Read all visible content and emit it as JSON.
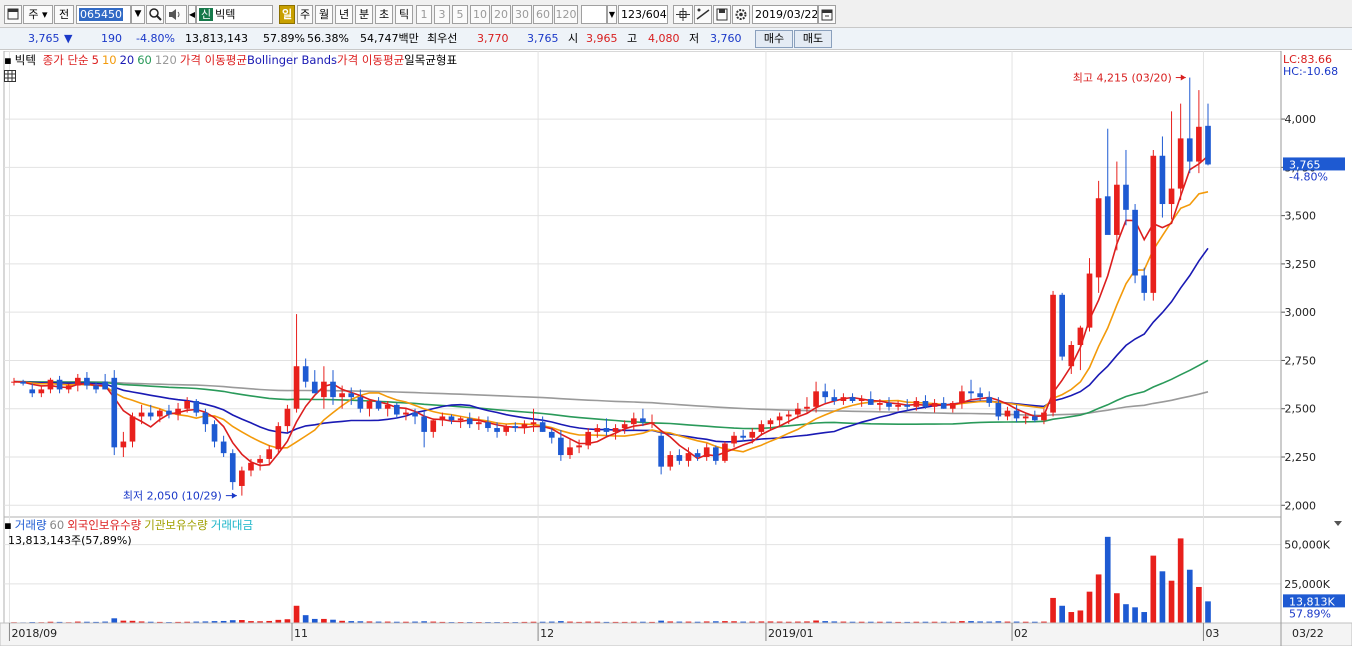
{
  "toolbar": {
    "type_selector": "주",
    "prev_label": "전",
    "stock_code": "065450",
    "badge": "신",
    "stock_name": "빅텍",
    "periods": [
      {
        "label": "일",
        "active": true
      },
      {
        "label": "주",
        "active": false
      },
      {
        "label": "월",
        "active": false
      },
      {
        "label": "년",
        "active": false
      },
      {
        "label": "분",
        "active": false
      },
      {
        "label": "초",
        "active": false
      },
      {
        "label": "틱",
        "active": false
      }
    ],
    "intervals": [
      "1",
      "3",
      "5",
      "10",
      "20",
      "30",
      "60",
      "120"
    ],
    "count_display": "123",
    "count_total": "/604",
    "date": "2019/03/22"
  },
  "quote": {
    "price": "3,765",
    "arrow": "▼",
    "change": "190",
    "change_pct": "-4.80%",
    "volume": "13,813,143",
    "volume_ratio": "57.89%",
    "turnover": "56.38%",
    "amount": "54,747백만",
    "best_label": "최우선",
    "best_ask": "3,770",
    "best_bid": "3,765",
    "open_label": "시",
    "open": "3,965",
    "high_label": "고",
    "high": "4,080",
    "low_label": "저",
    "low": "3,760",
    "buy_button": "매수",
    "sell_button": "매도"
  },
  "legend": {
    "name": "빅텍",
    "ma_title": "종가 단순",
    "ma_periods": [
      "5",
      "10",
      "20",
      "60",
      "120"
    ],
    "ma_label1": "가격 이동평균",
    "bollinger": "Bollinger Bands",
    "ma_label2": "가격 이동평균",
    "ichimoku": "일목균형표"
  },
  "volume_legend": {
    "volume": "거래량",
    "volume_period": "60",
    "foreign": "외국인보유수량",
    "institution": "기관보유수량",
    "amount": "거래대금",
    "sub": "13,813,143주(57,89%)"
  },
  "annotations": {
    "lc": "LC:83.66",
    "hc": "HC:-10.68",
    "high_label": "최고 4,215 (03/20)",
    "low_label": "최저 2,050 (10/29)",
    "price_tag": "3,765",
    "price_pct": "-4.80%",
    "vol_tag": "13,813K",
    "vol_pct": "57.89%",
    "last_date": "03/22"
  },
  "colors": {
    "up": "#e8201c",
    "down": "#1e5ad2",
    "ma5": "#dc1e1e",
    "ma10": "#f39a0a",
    "ma20": "#1a1ab4",
    "ma60": "#2a9a5a",
    "ma120": "#9a9a9a"
  },
  "chart_data": {
    "type": "candlestick",
    "title": "빅텍",
    "y_ticks": [
      2000,
      2250,
      2500,
      2750,
      3000,
      3250,
      3500,
      3750,
      4000
    ],
    "y_tick_labels": [
      "2,000",
      "2,250",
      "2,500",
      "2,750",
      "3,000",
      "3,250",
      "3,500",
      "3,750",
      "4,000"
    ],
    "ylim": [
      1960,
      4280
    ],
    "vol_ticks": [
      25000,
      50000
    ],
    "vol_tick_labels": [
      "25,000K",
      "50,000K"
    ],
    "vol_lim": [
      0,
      60000
    ],
    "x_labels": [
      {
        "label": "2018/09",
        "index": 0
      },
      {
        "label": "11",
        "index": 31
      },
      {
        "label": "12",
        "index": 58
      },
      {
        "label": "2019/01",
        "index": 83
      },
      {
        "label": "02",
        "index": 110
      },
      {
        "label": "03",
        "index": 131
      }
    ],
    "candles": [
      [
        2640,
        2660,
        2620,
        2640,
        500
      ],
      [
        2640,
        2650,
        2620,
        2630,
        400
      ],
      [
        2600,
        2630,
        2560,
        2580,
        600
      ],
      [
        2580,
        2620,
        2560,
        2600,
        500
      ],
      [
        2600,
        2660,
        2580,
        2650,
        800
      ],
      [
        2650,
        2670,
        2580,
        2600,
        700
      ],
      [
        2600,
        2630,
        2580,
        2620,
        500
      ],
      [
        2620,
        2680,
        2590,
        2660,
        900
      ],
      [
        2660,
        2690,
        2600,
        2620,
        800
      ],
      [
        2620,
        2640,
        2580,
        2600,
        700
      ],
      [
        2640,
        2680,
        2600,
        2600,
        900
      ],
      [
        2660,
        2700,
        2260,
        2300,
        3000
      ],
      [
        2300,
        2380,
        2250,
        2330,
        1500
      ],
      [
        2330,
        2480,
        2300,
        2460,
        1400
      ],
      [
        2460,
        2520,
        2420,
        2480,
        1000
      ],
      [
        2480,
        2520,
        2440,
        2460,
        800
      ],
      [
        2460,
        2500,
        2430,
        2490,
        700
      ],
      [
        2490,
        2520,
        2450,
        2470,
        600
      ],
      [
        2470,
        2530,
        2440,
        2500,
        700
      ],
      [
        2500,
        2560,
        2480,
        2540,
        800
      ],
      [
        2540,
        2550,
        2460,
        2480,
        900
      ],
      [
        2480,
        2500,
        2380,
        2420,
        1000
      ],
      [
        2420,
        2440,
        2300,
        2330,
        1200
      ],
      [
        2330,
        2360,
        2250,
        2270,
        1300
      ],
      [
        2270,
        2290,
        2080,
        2120,
        1800
      ],
      [
        2100,
        2200,
        2050,
        2180,
        1900
      ],
      [
        2180,
        2240,
        2150,
        2220,
        1200
      ],
      [
        2220,
        2260,
        2180,
        2240,
        1100
      ],
      [
        2240,
        2310,
        2210,
        2290,
        1300
      ],
      [
        2290,
        2430,
        2270,
        2410,
        2000
      ],
      [
        2410,
        2520,
        2380,
        2500,
        2400
      ],
      [
        2500,
        2990,
        2480,
        2720,
        11000
      ],
      [
        2720,
        2760,
        2610,
        2640,
        5000
      ],
      [
        2640,
        2700,
        2580,
        2580,
        2600
      ],
      [
        2560,
        2720,
        2500,
        2640,
        2600
      ],
      [
        2640,
        2700,
        2520,
        2560,
        2100
      ],
      [
        2560,
        2620,
        2500,
        2580,
        1400
      ],
      [
        2580,
        2610,
        2520,
        2560,
        1200
      ],
      [
        2560,
        2600,
        2480,
        2500,
        1100
      ],
      [
        2500,
        2550,
        2460,
        2540,
        1000
      ],
      [
        2540,
        2560,
        2490,
        2500,
        900
      ],
      [
        2500,
        2540,
        2460,
        2520,
        900
      ],
      [
        2520,
        2530,
        2450,
        2470,
        800
      ],
      [
        2470,
        2500,
        2440,
        2480,
        800
      ],
      [
        2480,
        2500,
        2420,
        2460,
        900
      ],
      [
        2460,
        2490,
        2300,
        2380,
        1100
      ],
      [
        2380,
        2450,
        2350,
        2440,
        900
      ],
      [
        2440,
        2480,
        2410,
        2460,
        700
      ],
      [
        2460,
        2470,
        2420,
        2440,
        600
      ],
      [
        2440,
        2460,
        2400,
        2450,
        600
      ],
      [
        2450,
        2480,
        2400,
        2420,
        600
      ],
      [
        2420,
        2460,
        2390,
        2430,
        600
      ],
      [
        2430,
        2460,
        2380,
        2400,
        600
      ],
      [
        2400,
        2430,
        2350,
        2380,
        600
      ],
      [
        2380,
        2420,
        2360,
        2410,
        600
      ],
      [
        2410,
        2430,
        2380,
        2400,
        600
      ],
      [
        2400,
        2440,
        2370,
        2420,
        700
      ],
      [
        2420,
        2500,
        2380,
        2430,
        800
      ],
      [
        2430,
        2460,
        2380,
        2380,
        800
      ],
      [
        2380,
        2400,
        2320,
        2350,
        900
      ],
      [
        2350,
        2390,
        2230,
        2260,
        1200
      ],
      [
        2260,
        2340,
        2240,
        2300,
        900
      ],
      [
        2300,
        2340,
        2270,
        2310,
        700
      ],
      [
        2310,
        2400,
        2290,
        2380,
        900
      ],
      [
        2380,
        2420,
        2350,
        2400,
        800
      ],
      [
        2400,
        2450,
        2360,
        2380,
        700
      ],
      [
        2380,
        2420,
        2340,
        2400,
        700
      ],
      [
        2400,
        2440,
        2370,
        2420,
        700
      ],
      [
        2420,
        2480,
        2390,
        2450,
        800
      ],
      [
        2450,
        2500,
        2410,
        2430,
        800
      ],
      [
        2430,
        2470,
        2400,
        2430,
        700
      ],
      [
        2360,
        2380,
        2160,
        2200,
        1500
      ],
      [
        2200,
        2280,
        2180,
        2260,
        1000
      ],
      [
        2260,
        2290,
        2210,
        2230,
        900
      ],
      [
        2230,
        2300,
        2200,
        2270,
        900
      ],
      [
        2270,
        2290,
        2230,
        2250,
        800
      ],
      [
        2250,
        2320,
        2230,
        2300,
        1000
      ],
      [
        2300,
        2310,
        2210,
        2230,
        1100
      ],
      [
        2230,
        2330,
        2220,
        2320,
        1200
      ],
      [
        2320,
        2380,
        2300,
        2360,
        1100
      ],
      [
        2360,
        2390,
        2330,
        2350,
        900
      ],
      [
        2350,
        2400,
        2320,
        2380,
        900
      ],
      [
        2380,
        2440,
        2360,
        2420,
        1000
      ],
      [
        2420,
        2450,
        2390,
        2440,
        1000
      ],
      [
        2440,
        2480,
        2410,
        2460,
        900
      ],
      [
        2460,
        2490,
        2420,
        2470,
        800
      ],
      [
        2470,
        2530,
        2450,
        2500,
        900
      ],
      [
        2500,
        2560,
        2480,
        2510,
        1000
      ],
      [
        2510,
        2640,
        2480,
        2590,
        1600
      ],
      [
        2590,
        2630,
        2530,
        2560,
        1200
      ],
      [
        2560,
        2600,
        2520,
        2540,
        1000
      ],
      [
        2540,
        2580,
        2520,
        2560,
        900
      ],
      [
        2560,
        2580,
        2530,
        2540,
        800
      ],
      [
        2540,
        2570,
        2510,
        2550,
        800
      ],
      [
        2550,
        2590,
        2520,
        2520,
        800
      ],
      [
        2520,
        2550,
        2490,
        2530,
        800
      ],
      [
        2530,
        2560,
        2490,
        2510,
        800
      ],
      [
        2510,
        2540,
        2490,
        2520,
        700
      ],
      [
        2520,
        2550,
        2490,
        2510,
        700
      ],
      [
        2510,
        2560,
        2490,
        2540,
        800
      ],
      [
        2540,
        2570,
        2500,
        2510,
        800
      ],
      [
        2510,
        2550,
        2480,
        2530,
        800
      ],
      [
        2530,
        2560,
        2500,
        2500,
        800
      ],
      [
        2500,
        2540,
        2480,
        2530,
        800
      ],
      [
        2530,
        2620,
        2500,
        2590,
        1200
      ],
      [
        2590,
        2650,
        2550,
        2580,
        1200
      ],
      [
        2580,
        2610,
        2540,
        2560,
        1000
      ],
      [
        2560,
        2590,
        2510,
        2530,
        900
      ],
      [
        2530,
        2560,
        2440,
        2460,
        1100
      ],
      [
        2460,
        2510,
        2440,
        2490,
        900
      ],
      [
        2490,
        2520,
        2430,
        2450,
        900
      ],
      [
        2450,
        2480,
        2420,
        2460,
        800
      ],
      [
        2460,
        2490,
        2430,
        2440,
        800
      ],
      [
        2440,
        2500,
        2420,
        2480,
        900
      ],
      [
        2480,
        3110,
        2460,
        3090,
        16000
      ],
      [
        3090,
        3100,
        2750,
        2770,
        11000
      ],
      [
        2720,
        2850,
        2680,
        2830,
        7000
      ],
      [
        2830,
        2930,
        2700,
        2920,
        8000
      ],
      [
        2920,
        3280,
        2900,
        3200,
        20000
      ],
      [
        3180,
        3680,
        3100,
        3590,
        31000
      ],
      [
        3600,
        3950,
        3420,
        3400,
        55000
      ],
      [
        3400,
        3780,
        3320,
        3660,
        19000
      ],
      [
        3660,
        3840,
        3450,
        3530,
        12000
      ],
      [
        3530,
        3560,
        3150,
        3190,
        10000
      ],
      [
        3190,
        3230,
        3060,
        3100,
        7000
      ],
      [
        3100,
        3840,
        3060,
        3810,
        43000
      ],
      [
        3810,
        3910,
        3490,
        3560,
        33000
      ],
      [
        3560,
        4040,
        3480,
        3640,
        27000
      ],
      [
        3640,
        4080,
        3580,
        3900,
        54000
      ],
      [
        3900,
        4215,
        3720,
        3780,
        34000
      ],
      [
        3780,
        4150,
        3720,
        3960,
        23000
      ],
      [
        3965,
        4080,
        3760,
        3765,
        13813
      ]
    ],
    "volume_series_note_free": true
  }
}
